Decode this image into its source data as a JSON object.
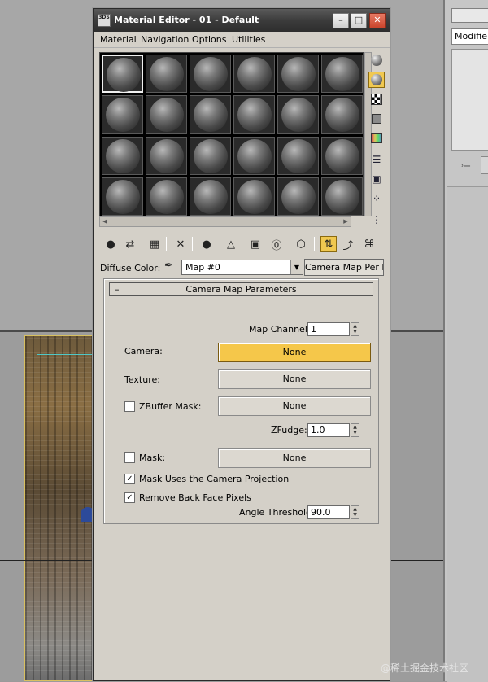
{
  "window": {
    "title": "Material Editor - 01 - Default",
    "app_icon_text": "3DS",
    "buttons": {
      "minimize": "–",
      "maximize": "□",
      "close": "✕"
    }
  },
  "menu": [
    "Material",
    "Navigation",
    "Options",
    "Utilities"
  ],
  "sample_slots": {
    "rows": 4,
    "cols": 6,
    "active_index": 0
  },
  "side_toolbar_icons": [
    "sample-type-sphere-icon",
    "backlight-icon",
    "checker-background-icon",
    "sample-uv-tiling-icon",
    "video-color-check-icon",
    "make-preview-icon",
    "options-icon",
    "select-by-material-icon",
    "material-map-navigator-icon"
  ],
  "bottom_toolbar_icons": [
    "get-material-icon",
    "put-to-scene-icon",
    "assign-to-selection-icon",
    "reset-map-icon",
    "make-unique-icon",
    "put-to-library-icon",
    "material-id-channel-icon",
    "show-map-in-viewport-icon",
    "show-end-result-icon",
    "go-to-parent-icon",
    "go-forward-to-sibling-icon"
  ],
  "diffuse": {
    "label": "Diffuse Color:",
    "map_value": "Map #0",
    "type_button": "Camera Map Per Pixel"
  },
  "rollout": {
    "toggle": "–",
    "title": "Camera Map Parameters",
    "map_channel_label": "Map Channel:",
    "map_channel_value": "1",
    "camera_label": "Camera:",
    "camera_value": "None",
    "texture_label": "Texture:",
    "texture_value": "None",
    "zbuffer_label": "ZBuffer Mask:",
    "zbuffer_value": "None",
    "zbuffer_checked": false,
    "zfudge_label": "ZFudge:",
    "zfudge_value": "1.0",
    "mask_label": "Mask:",
    "mask_value": "None",
    "mask_checked": false,
    "mask_uses_projection_label": "Mask Uses the Camera Projection",
    "mask_uses_projection_checked": true,
    "remove_back_faces_label": "Remove Back Face Pixels",
    "remove_back_faces_checked": true,
    "angle_threshold_label": "Angle Threshold:",
    "angle_threshold_value": "90.0"
  },
  "command_panel": {
    "modifier_list": "Modifier List"
  },
  "watermark": "@稀土掘金技术社区",
  "colors": {
    "active_button": "#f5c74a",
    "titlebar": "#3c3c3c",
    "panel": "#d4d0c8"
  }
}
